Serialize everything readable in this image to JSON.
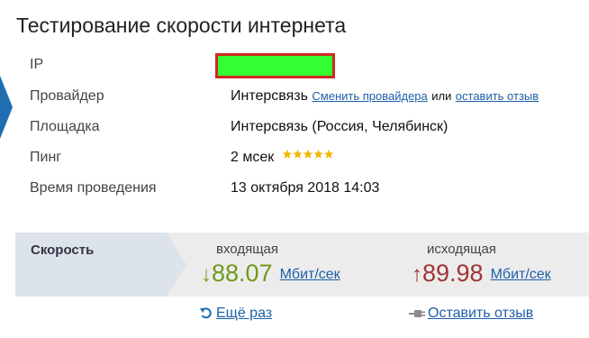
{
  "page": {
    "title": "Тестирование скорости интернета"
  },
  "info": {
    "ip": {
      "label": "IP",
      "value": "",
      "highlight_color": "#33ff33",
      "border_color": "#cc2a22"
    },
    "provider": {
      "label": "Провайдер",
      "value": "Интерсвязь",
      "change_link": "Сменить провайдера",
      "separator": "или",
      "review_link": "оставить отзыв"
    },
    "server": {
      "label": "Площадка",
      "value": "Интерсвязь (Россия, Челябинск)"
    },
    "ping": {
      "label": "Пинг",
      "value": "2 мсек",
      "rating_stars": 5,
      "star_color": "#f2b705"
    },
    "time": {
      "label": "Время проведения",
      "value": "13 октября 2018 14:03"
    }
  },
  "speed": {
    "label": "Скорость",
    "download": {
      "heading": "входящая",
      "arrow": "↓",
      "value": "88.07",
      "unit": "Мбит/сек",
      "color": "#6f9a1b"
    },
    "upload": {
      "heading": "исходящая",
      "arrow": "↑",
      "value": "89.98",
      "unit": "Мбит/сек",
      "color": "#a23434"
    }
  },
  "actions": {
    "retry": "Ещё раз",
    "leave_review": "Оставить отзыв"
  },
  "colors": {
    "link": "#1f5fa8",
    "panel_bg": "#ececec",
    "tab_bg": "#dde3ea",
    "accent_blue": "#1f6fb0"
  }
}
